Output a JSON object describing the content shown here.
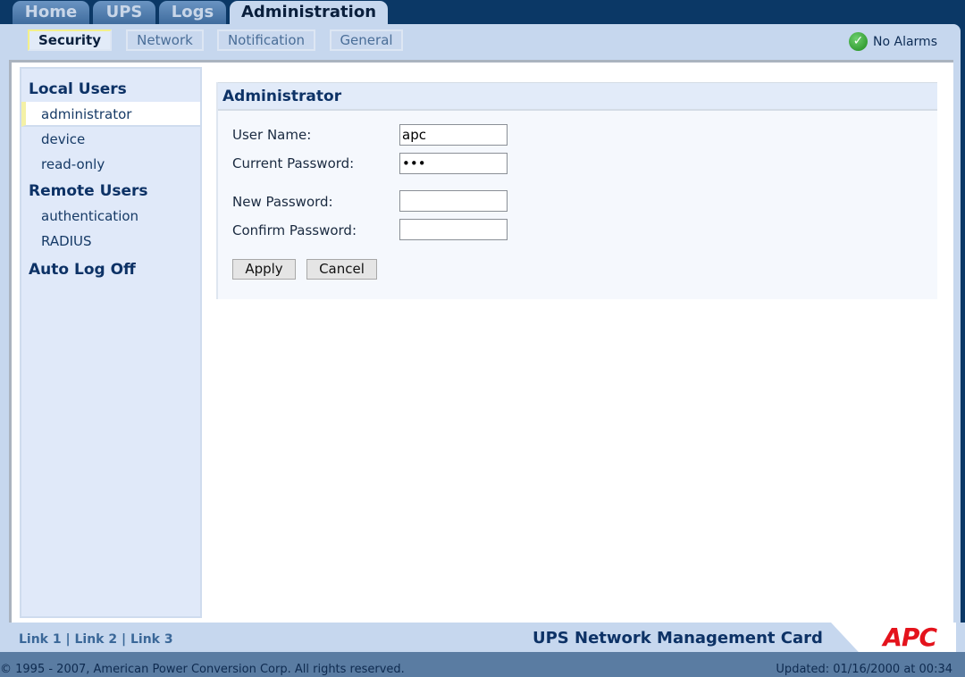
{
  "tabs": [
    "Home",
    "UPS",
    "Logs",
    "Administration"
  ],
  "subtabs": [
    "Security",
    "Network",
    "Notification",
    "General"
  ],
  "status": {
    "label": "No Alarms",
    "icon": "check-icon",
    "color": "#1d8a1d"
  },
  "sidebar": {
    "local_heading": "Local Users",
    "local_items": [
      "administrator",
      "device",
      "read-only"
    ],
    "remote_heading": "Remote Users",
    "remote_items": [
      "authentication",
      "RADIUS"
    ],
    "autologoff": "Auto Log Off"
  },
  "form": {
    "title": "Administrator",
    "user_name_label": "User Name:",
    "user_name": "apc",
    "current_password_label": "Current Password:",
    "current_password": "•••",
    "new_password_label": "New Password:",
    "new_password": "",
    "confirm_password_label": "Confirm Password:",
    "confirm_password": "",
    "apply": "Apply",
    "cancel": "Cancel"
  },
  "footer": {
    "link1": "Link 1",
    "link2": "Link 2",
    "link3": "Link 3",
    "sep": "|",
    "brand": "UPS Network Management Card",
    "logo": "APC",
    "copyright": "© 1995 - 2007, American Power Conversion Corp. All rights reserved.",
    "updated": "Updated: 01/16/2000 at 00:34"
  },
  "colors": {
    "accent": "#0d3266",
    "logo": "#e4131c"
  }
}
